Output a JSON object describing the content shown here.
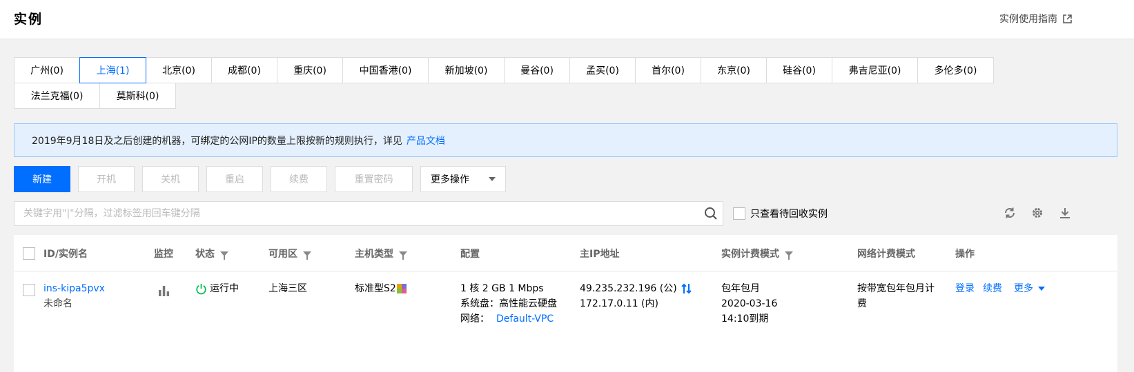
{
  "header": {
    "title": "实例",
    "guide_link": "实例使用指南"
  },
  "regions": [
    [
      {
        "label": "广州(0)",
        "active": false
      },
      {
        "label": "上海(1)",
        "active": true
      },
      {
        "label": "北京(0)",
        "active": false
      },
      {
        "label": "成都(0)",
        "active": false
      },
      {
        "label": "重庆(0)",
        "active": false
      },
      {
        "label": "中国香港(0)",
        "active": false
      },
      {
        "label": "新加坡(0)",
        "active": false
      },
      {
        "label": "曼谷(0)",
        "active": false
      },
      {
        "label": "孟买(0)",
        "active": false
      },
      {
        "label": "首尔(0)",
        "active": false
      },
      {
        "label": "东京(0)",
        "active": false
      },
      {
        "label": "硅谷(0)",
        "active": false
      },
      {
        "label": "弗吉尼亚(0)",
        "active": false
      },
      {
        "label": "多伦多(0)",
        "active": false
      }
    ],
    [
      {
        "label": "法兰克福(0)",
        "active": false
      },
      {
        "label": "莫斯科(0)",
        "active": false
      }
    ]
  ],
  "notice": {
    "text": "2019年9月18日及之后创建的机器，可绑定的公网IP的数量上限按新的规则执行，详见",
    "link": "产品文档"
  },
  "toolbar": {
    "new": "新建",
    "start": "开机",
    "shutdown": "关机",
    "restart": "重启",
    "renew": "续费",
    "reset_password": "重置密码",
    "more_actions": "更多操作"
  },
  "search": {
    "placeholder": "关键字用\"|\"分隔，过滤标签用回车键分隔"
  },
  "recycle_filter": {
    "label": "只查看待回收实例",
    "checked": false
  },
  "table": {
    "headers": {
      "id": "ID/实例名",
      "monitor": "监控",
      "status": "状态",
      "zone": "可用区",
      "type": "主机类型",
      "config": "配置",
      "ip": "主IP地址",
      "billing": "实例计费模式",
      "network_billing": "网络计费模式",
      "ops": "操作"
    },
    "rows": [
      {
        "id": "ins-kipa5pvx",
        "name": "未命名",
        "status": "运行中",
        "zone": "上海三区",
        "type": "标准型S2",
        "config_line1": "1 核 2 GB 1 Mbps",
        "config_line2": "系统盘：高性能云硬盘",
        "network_label": "网络：",
        "network_value": "Default-VPC",
        "public_ip": "49.235.232.196 (公)",
        "private_ip": "172.17.0.11 (内)",
        "billing_mode": "包年包月",
        "billing_date": "2020-03-16",
        "billing_expire": "14:10到期",
        "network_billing_line1": "按带宽包年包月计",
        "network_billing_line2": "费",
        "op_login": "登录",
        "op_renew": "续费",
        "op_more": "更多"
      }
    ]
  },
  "colors": {
    "accent": "#006eff",
    "running": "#0abf5b",
    "notice_bg": "#e5f0ff"
  }
}
